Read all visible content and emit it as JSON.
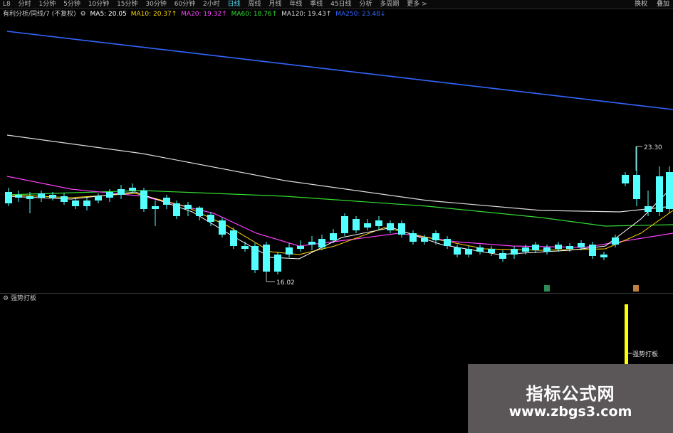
{
  "toolbar": {
    "items": [
      "L8",
      "分时",
      "1分钟",
      "5分钟",
      "10分钟",
      "15分钟",
      "30分钟",
      "60分钟",
      "2小时",
      "日线",
      "周线",
      "月线",
      "年线",
      "季线",
      "45日线",
      "分析",
      "多周期",
      "更多 >"
    ],
    "active_index": 9,
    "right_items": [
      "换权",
      "叠加"
    ]
  },
  "ma_row": {
    "title": "有利分析/同线/7 (不复权)",
    "gear": "⚙",
    "items": [
      {
        "label": "MA5: 20.05",
        "color": "#ffffff"
      },
      {
        "label": "MA10: 20.37↑",
        "color": "#ffd700"
      },
      {
        "label": "MA20: 19.32↑",
        "color": "#ff40ff"
      },
      {
        "label": "MA60: 18.76↑",
        "color": "#33dd33"
      },
      {
        "label": "MA120: 19.43↑",
        "color": "#dddddd"
      },
      {
        "label": "MA250: 23.48↓",
        "color": "#3366ff"
      }
    ]
  },
  "annotations": {
    "high_label": "23.30",
    "low_label": "16.02"
  },
  "subchart": {
    "title": "强势打板",
    "signal_label": "强势打板"
  },
  "watermark": {
    "line1": "指标公式网",
    "line2": "www.zbgs3.com"
  },
  "colors": {
    "up": "#ff4040",
    "down": "#54ffff",
    "ma5": "#ffffff",
    "ma10": "#ffd700",
    "ma20": "#ff40ff",
    "ma60": "#33dd33",
    "ma120": "#dddddd",
    "ma250": "#3366ff",
    "signal": "#ffff00"
  }
}
